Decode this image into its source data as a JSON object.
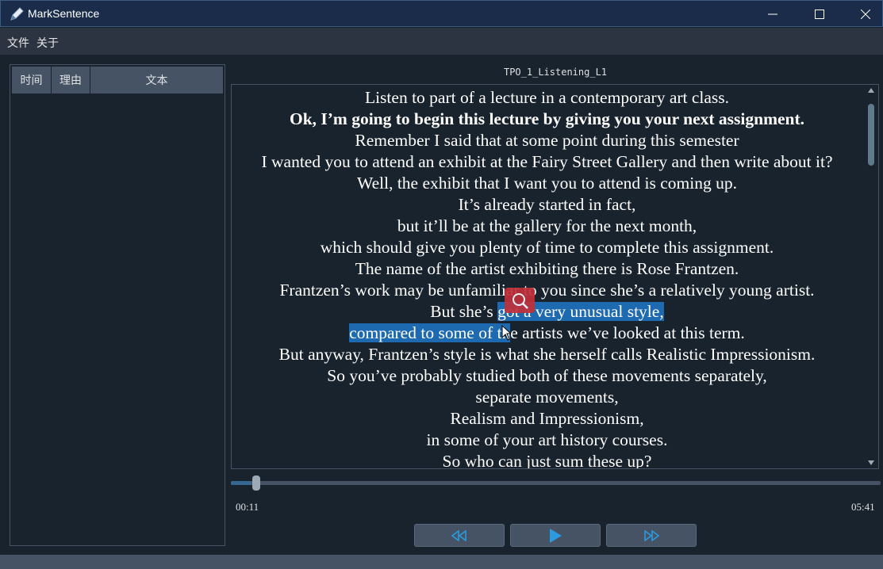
{
  "window": {
    "title": "MarkSentence"
  },
  "menu": [
    "文件",
    "关于"
  ],
  "table": {
    "headers": [
      "时间",
      "理由",
      "文本"
    ]
  },
  "document": {
    "title": "TPO_1_Listening_L1",
    "lines": [
      "Listen to part of a lecture in a contemporary art class.",
      "Ok, I’m going to begin this lecture by giving you your next assignment.",
      "Remember I said that at some point during this semester",
      "I wanted you to attend an exhibit at the Fairy Street Gallery and then write about it?",
      "Well, the exhibit that I want you to attend is coming up.",
      "It’s already started in fact,",
      "but it’ll be at the gallery for the next month,",
      "which should give you plenty of time to complete this assignment.",
      "The name of the artist exhibiting there is Rose Frantzen.",
      "Frantzen’s work may be unfamiliar to you since she’s a relatively young artist.",
      "But she’s got a very unusual style,",
      "compared to some of the artists we’ve looked at this term.",
      "But anyway, Frantzen’s style is what she herself calls Realistic Impressionism.",
      "So you’ve probably studied both of these movements separately,",
      "separate movements,",
      "Realism and Impressionism,",
      "in some of your art history courses.",
      "So who can just sum these up?"
    ],
    "bold_line_index": 1,
    "selection": {
      "line10_before": "But she’s ",
      "line10_selected": "got a very unusual style, ",
      "line11_selected": "compared to some of th",
      "line11_after": "e artists we’ve looked at this term."
    }
  },
  "player": {
    "current_time": "00:11",
    "total_time": "05:41",
    "progress": 0.0323
  },
  "colors": {
    "accent": "#1e6ab0",
    "background": "#19232d",
    "panel": "#455364",
    "titlebar": "#1a2c4a",
    "icon_blue": "#2b9ae0",
    "overlay_red": "#c0303a"
  },
  "icons": {
    "app": "pen-icon",
    "minimize": "minimize-icon",
    "maximize": "maximize-icon",
    "close": "close-icon",
    "rewind": "rewind-icon",
    "play": "play-icon",
    "forward": "fast-forward-icon",
    "translate": "magnifier-icon"
  }
}
